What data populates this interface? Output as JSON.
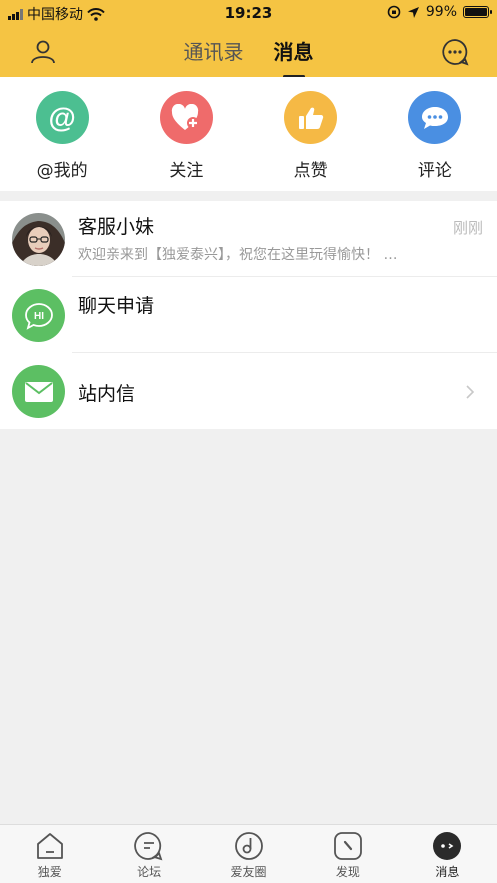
{
  "status_bar": {
    "carrier": "中国移动",
    "time": "19:23",
    "battery": "99%"
  },
  "nav": {
    "tabs": [
      "通讯录",
      "消息"
    ],
    "active_tab": "消息"
  },
  "quick_actions": [
    {
      "label": "@我的",
      "icon": "at-icon",
      "color": "#4cbf91"
    },
    {
      "label": "关注",
      "icon": "heart-plus-icon",
      "color": "#ef6b6b"
    },
    {
      "label": "点赞",
      "icon": "thumbs-up-icon",
      "color": "#f5b945"
    },
    {
      "label": "评论",
      "icon": "chat-bubble-icon",
      "color": "#4a8fe2"
    }
  ],
  "messages": [
    {
      "title": "客服小妹",
      "preview": "欢迎亲来到【独爱泰兴】，祝您在这里玩得愉快！  …",
      "time": "刚刚",
      "icon": "avatar-photo"
    },
    {
      "title": "聊天申请",
      "icon": "hi-chat-icon",
      "badge": "HI",
      "color": "#5cbf63"
    },
    {
      "title": "站内信",
      "icon": "mail-icon",
      "color": "#5cbf63"
    }
  ],
  "tabbar": [
    {
      "label": "独爱",
      "icon": "home-icon"
    },
    {
      "label": "论坛",
      "icon": "forum-icon"
    },
    {
      "label": "爱友圈",
      "icon": "music-circle-icon"
    },
    {
      "label": "发现",
      "icon": "compass-icon"
    },
    {
      "label": "消息",
      "icon": "message-icon",
      "active": true
    }
  ]
}
